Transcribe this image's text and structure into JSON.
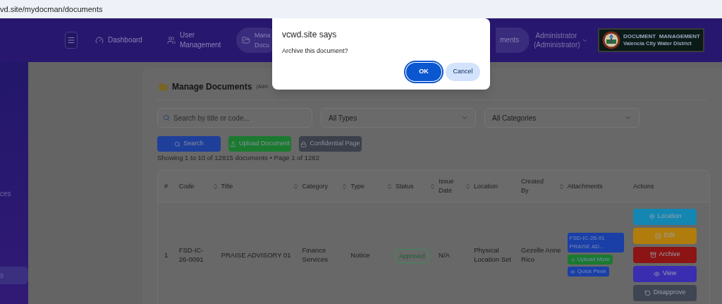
{
  "browser": {
    "url": "vd.site/mydocman/documents"
  },
  "header": {
    "nav": [
      {
        "label": "Dashboard",
        "selected": false
      },
      {
        "label": "User Management",
        "selected": false
      },
      {
        "label": "Mana Docu",
        "selected": true
      },
      {
        "label": "ments",
        "selected": true
      }
    ],
    "user": "Administrator (Administrator)",
    "logo": {
      "title": "DOCUMENT  MANAGEMENT",
      "subtitle": "Valencia City Water District"
    }
  },
  "sidebar": {
    "items": [
      {
        "label": "ces",
        "selected": false
      },
      {
        "label": "s",
        "selected": true
      }
    ]
  },
  "card": {
    "title": "Manage Documents",
    "subtitle": "(Adm",
    "search": {
      "placeholder": "Search by title or code..."
    },
    "filters": [
      {
        "value": "All Types"
      },
      {
        "value": "All Categories"
      }
    ],
    "buttons": [
      {
        "label": "Search",
        "color": "#1e3f9a"
      },
      {
        "label": "Upload Document",
        "color": "#1b7a30"
      },
      {
        "label": "Confidential Page",
        "color": "#3b404a"
      }
    ],
    "summary": "Showing 1 to 10 of 12815 documents • Page 1 of 1282"
  },
  "table": {
    "columns": [
      {
        "label": "#",
        "sortable": false
      },
      {
        "label": "Code",
        "sortable": true
      },
      {
        "label": "Title",
        "sortable": true
      },
      {
        "label": "Category",
        "sortable": true
      },
      {
        "label": "Type",
        "sortable": true
      },
      {
        "label": "Status",
        "sortable": true
      },
      {
        "label": "Issue Date",
        "sortable": true
      },
      {
        "label": "Location",
        "sortable": false
      },
      {
        "label": "Created By",
        "sortable": true
      },
      {
        "label": "Attachments",
        "sortable": false
      },
      {
        "label": "Actions",
        "sortable": false
      }
    ],
    "rows": [
      {
        "number": "1",
        "code": "FSD-IC-26-0091",
        "title": "PRAISE ADVISORY 01",
        "category": "Finance Services",
        "type": "Notice",
        "status": "Approved",
        "issue_date": "N/A",
        "location": "Physical Location Set",
        "created_by": "Gezelle Anne Rico",
        "attachments": [
          {
            "kind": "file",
            "label": "FSD-IC-26-91 PRAISE AD...",
            "color": "#1a3fa6"
          },
          {
            "kind": "upload",
            "label": "Upload More",
            "color": "#1b7a30"
          },
          {
            "kind": "peek",
            "label": "Quick Peek",
            "color": "#1a3fa6"
          }
        ],
        "actions": [
          {
            "label": "Location",
            "color": "#1486b2"
          },
          {
            "label": "Edit",
            "color": "#b07c0c"
          },
          {
            "label": "Archive",
            "color": "#8c1414"
          },
          {
            "label": "View",
            "color": "#3b2db0"
          },
          {
            "label": "Disapprove",
            "color": "#3f4552"
          }
        ]
      }
    ]
  },
  "dialog": {
    "title": "vcwd.site says",
    "message": "Archive this document?",
    "buttons": [
      {
        "label": "OK",
        "primary": true
      },
      {
        "label": "Cancel",
        "primary": false
      }
    ]
  }
}
